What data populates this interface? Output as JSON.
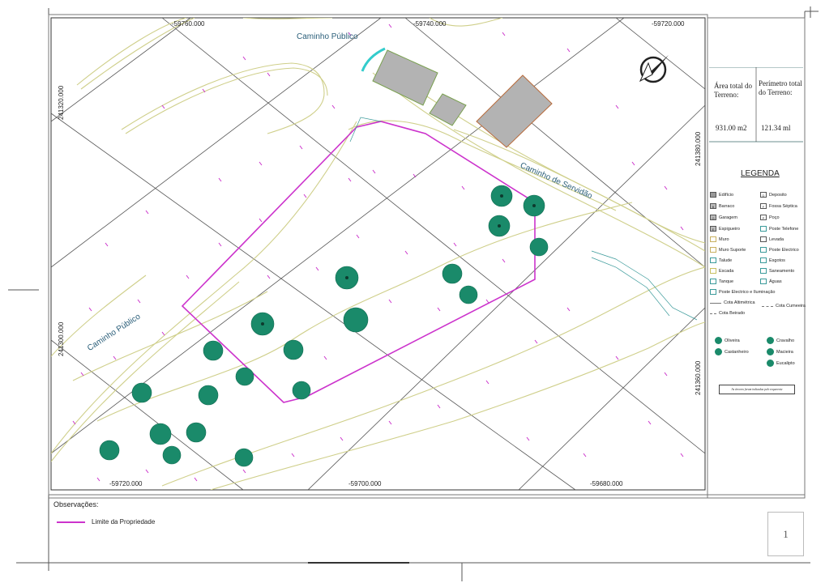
{
  "map": {
    "x_coords": [
      "-59760.000",
      "-59740.000",
      "-59720.000",
      "-59720.000",
      "-59700.000",
      "-59680.000"
    ],
    "y_coords": [
      "241320.000",
      "241300.000",
      "241380.000",
      "241360.000"
    ],
    "road_labels": [
      "Caminho Público",
      "Caminho de Servidão",
      "Caminho Público"
    ]
  },
  "info": {
    "area_label": "Área total do Terreno:",
    "area_value": "931.00 m2",
    "perimeter_label": "Perímetro total do Terreno:",
    "perimeter_value": "121.34 ml"
  },
  "legend": {
    "title": "LEGENDA",
    "items_left": [
      {
        "code": "",
        "label": "Edifício"
      },
      {
        "code": "B",
        "label": "Barraco"
      },
      {
        "code": "G",
        "label": "Garagem"
      },
      {
        "code": "E",
        "label": "Espigueiro"
      },
      {
        "code": "",
        "label": "Muro"
      },
      {
        "code": "",
        "label": "Muro Suporte"
      },
      {
        "code": "",
        "label": "Talude"
      },
      {
        "code": "",
        "label": "Escada"
      },
      {
        "code": "",
        "label": "Tanque"
      }
    ],
    "items_right": [
      {
        "code": "D",
        "label": "Deposito"
      },
      {
        "code": "F",
        "label": "Fossa Séptica"
      },
      {
        "code": "P",
        "label": "Poço"
      },
      {
        "code": "",
        "label": "Poste Telefone"
      },
      {
        "code": "",
        "label": "Levada"
      },
      {
        "code": "",
        "label": "Poste Electrico"
      },
      {
        "code": "",
        "label": "Esgotos"
      },
      {
        "code": "",
        "label": "Saneamento"
      },
      {
        "code": "",
        "label": "Águas"
      }
    ],
    "extra_items": [
      "Poste Electrico e Iluminação",
      "Cota Altimétrica",
      "Cota Cumeeira",
      "Cota Beirado"
    ],
    "trees": [
      "Oliveira",
      "Cravalho",
      "Castanheiro",
      "Macieira",
      "Eucalipto"
    ],
    "note": "As árvores foram indicadas pelo requerente"
  },
  "observations": {
    "label": "Observações:",
    "boundary_label": "Limite da Propriedade"
  },
  "colors": {
    "boundary": "#cc33cc",
    "tree": "#1a8a6a",
    "building": "#b3b3b3",
    "contour": "#cfcf8a"
  },
  "page_number": "1"
}
